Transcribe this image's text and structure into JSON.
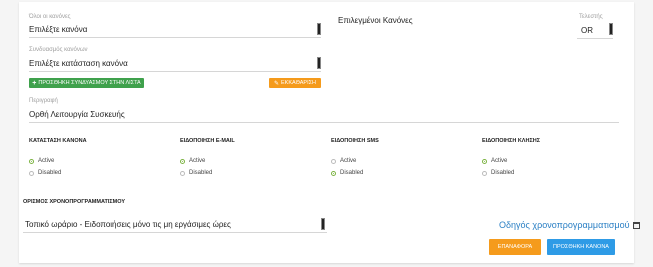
{
  "rule_type": {
    "label": "Όλοι οι κανόνες",
    "value": "Επιλέξτε κανόνα"
  },
  "selected_rules": {
    "title": "Επιλεγμένοι Κανόνες"
  },
  "operator": {
    "label": "Τελεστής",
    "value": "OR"
  },
  "rule_combination": {
    "label": "Συνδυασμός κανόνων",
    "value": "Επιλέξτε κατάσταση κανόνα"
  },
  "buttons": {
    "add_combination": "ΠΡΟΣΘΗΚΗ ΣΥΝΔΥΑΣΜΟΥ ΣΤΗΝ ΛΙΣΤΑ",
    "clear": "ΕΚΚΑΘΑΡΙΣΗ",
    "reset": "ΕΠΑΝΑΦΟΡΑ",
    "add_rule": "ΠΡΟΣΘΗΚΗ ΚΑΝΟΝΑ"
  },
  "description": {
    "label": "Περιγραφή",
    "value": "Ορθή Λειτουργία Συσκευής"
  },
  "status_groups": [
    {
      "title": "ΚΑΤΑΣΤΑΣΗ ΚΑΝΟΝΑ",
      "options": [
        "Active",
        "Disabled"
      ],
      "selected": 0
    },
    {
      "title": "ΕΙΔΟΠΟΙΗΣΗ E-MAIL",
      "options": [
        "Active",
        "Disabled"
      ],
      "selected": 0
    },
    {
      "title": "ΕΙΔΟΠΟΙΗΣΗ SMS",
      "options": [
        "Active",
        "Disabled"
      ],
      "selected": 1
    },
    {
      "title": "ΕΙΔΟΠΟΙΗΣΗ ΚΛΗΣΗΣ",
      "options": [
        "Active",
        "Disabled"
      ],
      "selected": 0
    }
  ],
  "scheduling": {
    "title": "ΟΡΙΣΜΟΣ ΧΡΟΝΟΠΡΟΓΡΑΜΜΑΤΙΣΜΟΥ",
    "value": "Τοπικό ωράριο - Ειδοποιήσεις μόνο τις μη εργάσιμες ώρες",
    "guide_link": "Οδηγός χρονοπρογραμματισμού"
  },
  "colors": {
    "green": "#3fa14c",
    "orange": "#f59b1c",
    "blue": "#2e9be6",
    "link": "#2a7fc4",
    "radio_on": "#7cb342"
  },
  "icons": {
    "add": "plus-icon",
    "clear": "eraser-icon",
    "calendar": "calendar-icon"
  }
}
